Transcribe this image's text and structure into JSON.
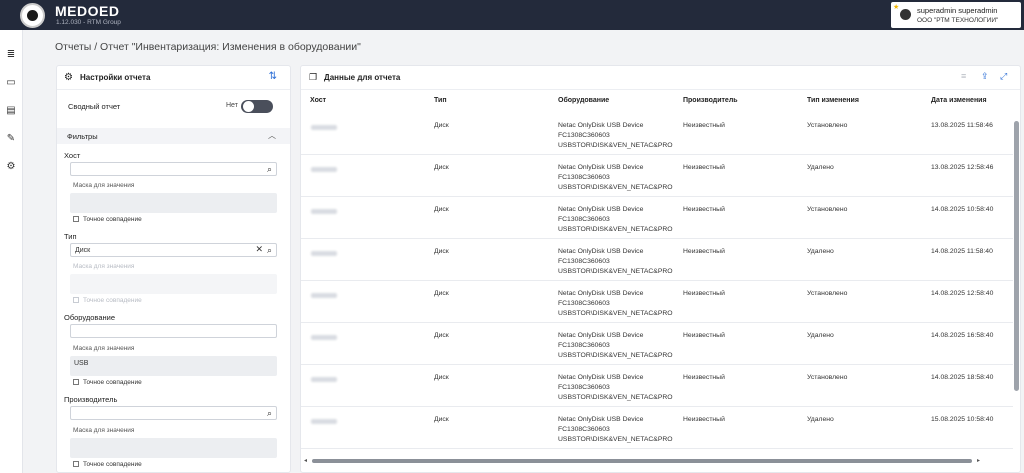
{
  "header": {
    "brand": "MEDOED",
    "version": "1.12.030 - RTM Group",
    "user_name": "superadmin superadmin",
    "user_org": "ООО \"РТМ ТЕХНОЛОГИИ\""
  },
  "page_title": "Отчеты / Отчет \"Инвентаризация: Изменения в оборудовании\"",
  "settings": {
    "title": "Настройки отчета",
    "summary_label": "Сводный отчет",
    "summary_state": "Нет",
    "filters_label": "Фильтры",
    "host": {
      "label": "Хост",
      "value": "",
      "mask_label": "Маска для значения",
      "mask_value": "",
      "exact_label": "Точное совпадение"
    },
    "type": {
      "label": "Тип",
      "value": "Диск",
      "mask_label": "Маска для значения",
      "mask_value": "",
      "exact_label": "Точное совпадение"
    },
    "equipment": {
      "label": "Оборудование",
      "value": "",
      "mask_label": "Маска для значения",
      "mask_value": "USB",
      "exact_label": "Точное совпадение"
    },
    "manufacturer": {
      "label": "Производитель",
      "value": "",
      "mask_label": "Маска для значения",
      "mask_value": "",
      "exact_label": "Точное совпадение"
    }
  },
  "data_panel": {
    "title": "Данные для отчета",
    "columns": [
      "Хост",
      "Тип",
      "Оборудование",
      "Производитель",
      "Тип изменения",
      "Дата изменения"
    ],
    "rows": [
      {
        "type": "Диск",
        "equip1": "Netac OnlyDisk USB Device",
        "equip2": "FC1308C360603",
        "equip3": "USBSTOR\\DISK&VEN_NETAC&PRO",
        "maker": "Неизвестный",
        "change": "Установлено",
        "date": "13.08.2025 11:58:46"
      },
      {
        "type": "Диск",
        "equip1": "Netac OnlyDisk USB Device",
        "equip2": "FC1308C360603",
        "equip3": "USBSTOR\\DISK&VEN_NETAC&PRO",
        "maker": "Неизвестный",
        "change": "Удалено",
        "date": "13.08.2025 12:58:46"
      },
      {
        "type": "Диск",
        "equip1": "Netac OnlyDisk USB Device",
        "equip2": "FC1308C360603",
        "equip3": "USBSTOR\\DISK&VEN_NETAC&PRO",
        "maker": "Неизвестный",
        "change": "Установлено",
        "date": "14.08.2025 10:58:40"
      },
      {
        "type": "Диск",
        "equip1": "Netac OnlyDisk USB Device",
        "equip2": "FC1308C360603",
        "equip3": "USBSTOR\\DISK&VEN_NETAC&PRO",
        "maker": "Неизвестный",
        "change": "Удалено",
        "date": "14.08.2025 11:58:40"
      },
      {
        "type": "Диск",
        "equip1": "Netac OnlyDisk USB Device",
        "equip2": "FC1308C360603",
        "equip3": "USBSTOR\\DISK&VEN_NETAC&PRO",
        "maker": "Неизвестный",
        "change": "Установлено",
        "date": "14.08.2025 12:58:40"
      },
      {
        "type": "Диск",
        "equip1": "Netac OnlyDisk USB Device",
        "equip2": "FC1308C360603",
        "equip3": "USBSTOR\\DISK&VEN_NETAC&PRO",
        "maker": "Неизвестный",
        "change": "Удалено",
        "date": "14.08.2025 16:58:40"
      },
      {
        "type": "Диск",
        "equip1": "Netac OnlyDisk USB Device",
        "equip2": "FC1308C360603",
        "equip3": "USBSTOR\\DISK&VEN_NETAC&PRO",
        "maker": "Неизвестный",
        "change": "Установлено",
        "date": "14.08.2025 18:58:40"
      },
      {
        "type": "Диск",
        "equip1": "Netac OnlyDisk USB Device",
        "equip2": "FC1308C360603",
        "equip3": "USBSTOR\\DISK&VEN_NETAC&PRO",
        "maker": "Неизвестный",
        "change": "Удалено",
        "date": "15.08.2025 10:58:40"
      }
    ]
  },
  "colors": {
    "topbar": "#232a3b",
    "accent": "#2d6fd6"
  },
  "icons": [
    "list-icon",
    "book-icon",
    "document-icon",
    "edit-icon",
    "gear-icon",
    "filter-settings-icon",
    "search-icon",
    "clear-icon",
    "chevron-up-icon",
    "copy-icon",
    "export-icon",
    "fullscreen-icon"
  ]
}
